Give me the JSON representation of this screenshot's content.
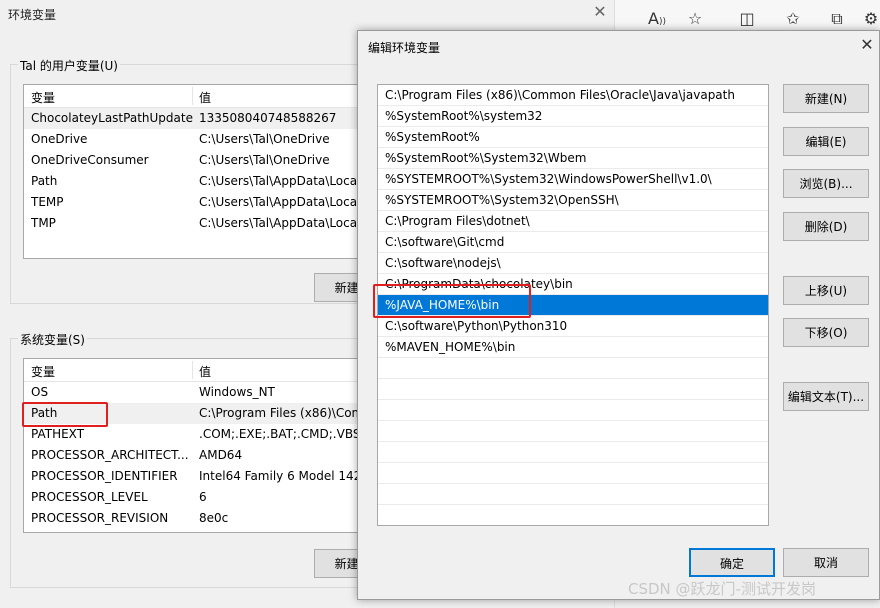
{
  "env_window": {
    "title": "环境变量",
    "user_vars": {
      "group_label": "Tal 的用户变量(U)",
      "col_var": "变量",
      "col_val": "值",
      "rows": [
        {
          "name": "ChocolateyLastPathUpdate",
          "value": "133508040748588267"
        },
        {
          "name": "OneDrive",
          "value": "C:\\Users\\Tal\\OneDrive"
        },
        {
          "name": "OneDriveConsumer",
          "value": "C:\\Users\\Tal\\OneDrive"
        },
        {
          "name": "Path",
          "value": "C:\\Users\\Tal\\AppData\\Loca"
        },
        {
          "name": "TEMP",
          "value": "C:\\Users\\Tal\\AppData\\Loca"
        },
        {
          "name": "TMP",
          "value": "C:\\Users\\Tal\\AppData\\Loca"
        }
      ],
      "new_button": "新建("
    },
    "system_vars": {
      "group_label": "系统变量(S)",
      "col_var": "变量",
      "col_val": "值",
      "rows": [
        {
          "name": "OS",
          "value": "Windows_NT"
        },
        {
          "name": "Path",
          "value": "C:\\Program Files (x86)\\Com"
        },
        {
          "name": "PATHEXT",
          "value": ".COM;.EXE;.BAT;.CMD;.VBS;."
        },
        {
          "name": "PROCESSOR_ARCHITECT...",
          "value": "AMD64"
        },
        {
          "name": "PROCESSOR_IDENTIFIER",
          "value": "Intel64 Family 6 Model 142"
        },
        {
          "name": "PROCESSOR_LEVEL",
          "value": "6"
        },
        {
          "name": "PROCESSOR_REVISION",
          "value": "8e0c"
        }
      ],
      "new_button": "新建("
    }
  },
  "edit_dialog": {
    "title": "编辑环境变量",
    "entries": [
      "C:\\Program Files (x86)\\Common Files\\Oracle\\Java\\javapath",
      "%SystemRoot%\\system32",
      "%SystemRoot%",
      "%SystemRoot%\\System32\\Wbem",
      "%SYSTEMROOT%\\System32\\WindowsPowerShell\\v1.0\\",
      "%SYSTEMROOT%\\System32\\OpenSSH\\",
      "C:\\Program Files\\dotnet\\",
      "C:\\software\\Git\\cmd",
      "C:\\software\\nodejs\\",
      "C:\\ProgramData\\chocolatey\\bin",
      "%JAVA_HOME%\\bin",
      "C:\\software\\Python\\Python310",
      "%MAVEN_HOME%\\bin"
    ],
    "selected_index": 10,
    "buttons": {
      "new": "新建(N)",
      "edit": "编辑(E)",
      "browse": "浏览(B)...",
      "delete": "删除(D)",
      "move_up": "上移(U)",
      "move_down": "下移(O)",
      "edit_text": "编辑文本(T)...",
      "ok": "确定",
      "cancel": "取消"
    }
  },
  "watermark": "CSDN @跃龙门-测试开发岗",
  "colors": {
    "selection": "#0078d7",
    "highlight_box": "#e02020"
  }
}
